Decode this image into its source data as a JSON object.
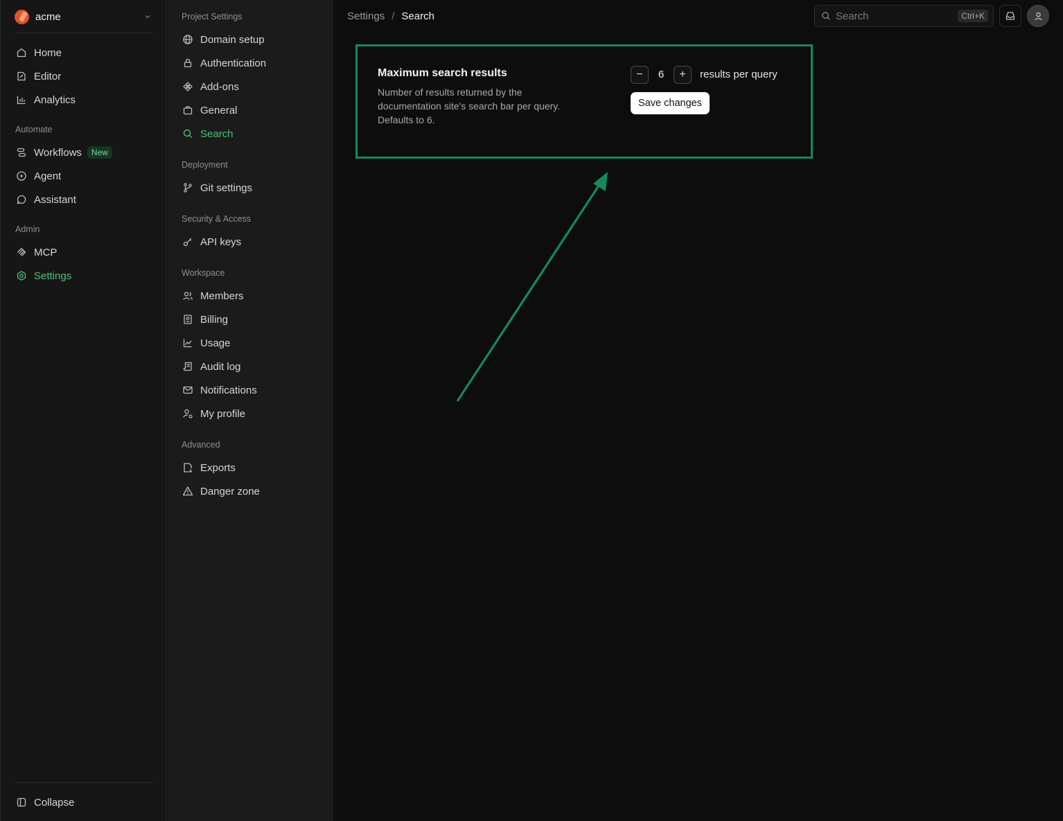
{
  "org": {
    "name": "acme"
  },
  "sidebar": {
    "items": [
      {
        "label": "Home",
        "icon": "home-icon"
      },
      {
        "label": "Editor",
        "icon": "edit-icon"
      },
      {
        "label": "Analytics",
        "icon": "bar-chart-icon"
      }
    ],
    "automate_label": "Automate",
    "automate_items": [
      {
        "label": "Workflows",
        "icon": "workflow-icon",
        "badge": "New"
      },
      {
        "label": "Agent",
        "icon": "agent-icon"
      },
      {
        "label": "Assistant",
        "icon": "chat-icon"
      }
    ],
    "admin_label": "Admin",
    "admin_items": [
      {
        "label": "MCP",
        "icon": "mcp-icon"
      },
      {
        "label": "Settings",
        "icon": "gear-icon",
        "active": true
      }
    ],
    "collapse_label": "Collapse"
  },
  "subnav": {
    "project_label": "Project Settings",
    "project_items": [
      {
        "label": "Domain setup",
        "icon": "globe-icon"
      },
      {
        "label": "Authentication",
        "icon": "lock-icon"
      },
      {
        "label": "Add-ons",
        "icon": "addons-icon"
      },
      {
        "label": "General",
        "icon": "briefcase-icon"
      },
      {
        "label": "Search",
        "icon": "search-icon",
        "active": true
      }
    ],
    "deployment_label": "Deployment",
    "deployment_items": [
      {
        "label": "Git settings",
        "icon": "git-branch-icon"
      }
    ],
    "security_label": "Security & Access",
    "security_items": [
      {
        "label": "API keys",
        "icon": "key-icon"
      }
    ],
    "workspace_label": "Workspace",
    "workspace_items": [
      {
        "label": "Members",
        "icon": "users-icon"
      },
      {
        "label": "Billing",
        "icon": "receipt-icon"
      },
      {
        "label": "Usage",
        "icon": "line-chart-icon"
      },
      {
        "label": "Audit log",
        "icon": "scroll-icon"
      },
      {
        "label": "Notifications",
        "icon": "mail-icon"
      },
      {
        "label": "My profile",
        "icon": "user-gear-icon"
      }
    ],
    "advanced_label": "Advanced",
    "advanced_items": [
      {
        "label": "Exports",
        "icon": "export-icon"
      },
      {
        "label": "Danger zone",
        "icon": "warning-icon"
      }
    ]
  },
  "breadcrumb": {
    "parent": "Settings",
    "separator": "/",
    "current": "Search"
  },
  "search": {
    "placeholder": "Search",
    "shortcut": "Ctrl+K"
  },
  "card": {
    "title": "Maximum search results",
    "description": "Number of results returned by the documentation site's search bar per query. Defaults to 6.",
    "decrement": "−",
    "increment": "+",
    "value": "6",
    "unit": "results per query",
    "save_label": "Save changes"
  },
  "colors": {
    "accent": "#4fc07a",
    "highlight": "#148a5a",
    "background": "#0d0d0d"
  }
}
